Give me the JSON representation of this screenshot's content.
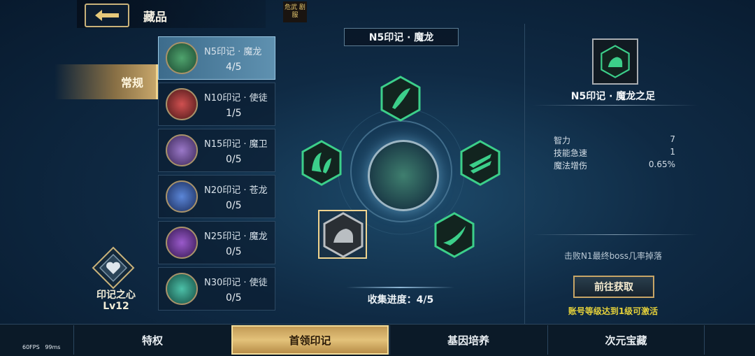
{
  "header": {
    "title": "藏品",
    "logo_text": "危武 剧服"
  },
  "category": {
    "label": "常规"
  },
  "collection_list": [
    {
      "name": "N5印记 · 魔龙",
      "count": "4/5",
      "color": "#3f8a5a"
    },
    {
      "name": "N10印记 · 使徒",
      "count": "1/5",
      "color": "#b33b3b"
    },
    {
      "name": "N15印记 · 魔卫",
      "count": "0/5",
      "color": "#7e5ba6"
    },
    {
      "name": "N20印记 · 苍龙",
      "count": "0/5",
      "color": "#3f63b5"
    },
    {
      "name": "N25印记 · 魔龙",
      "count": "0/5",
      "color": "#7a3fa0"
    },
    {
      "name": "N30印记 · 使徒",
      "count": "0/5",
      "color": "#2f9a8a"
    }
  ],
  "heart": {
    "label": "印记之心",
    "level": "Lv12"
  },
  "center": {
    "title": "N5印记 · 魔龙",
    "progress": "收集进度：4/5"
  },
  "detail": {
    "title": "N5印记 · 魔龙之足",
    "stats": [
      {
        "name": "智力",
        "value": "7"
      },
      {
        "name": "技能急速",
        "value": "1"
      },
      {
        "name": "魔法增伤",
        "value": "0.65%"
      }
    ],
    "drop_text": "击败N1最终boss几率掉落",
    "go_button": "前往获取",
    "activate_text": "账号等级达到1级可激活"
  },
  "bottom_tabs": [
    {
      "label": "特权"
    },
    {
      "label": "首领印记"
    },
    {
      "label": "基因培养"
    },
    {
      "label": "次元宝藏"
    }
  ],
  "debug": {
    "fps": "60FPS",
    "ms": "99ms"
  },
  "colors": {
    "accent_green": "#3ccf8a",
    "gold": "#c7a567",
    "activate_yellow": "#e6d23a"
  }
}
